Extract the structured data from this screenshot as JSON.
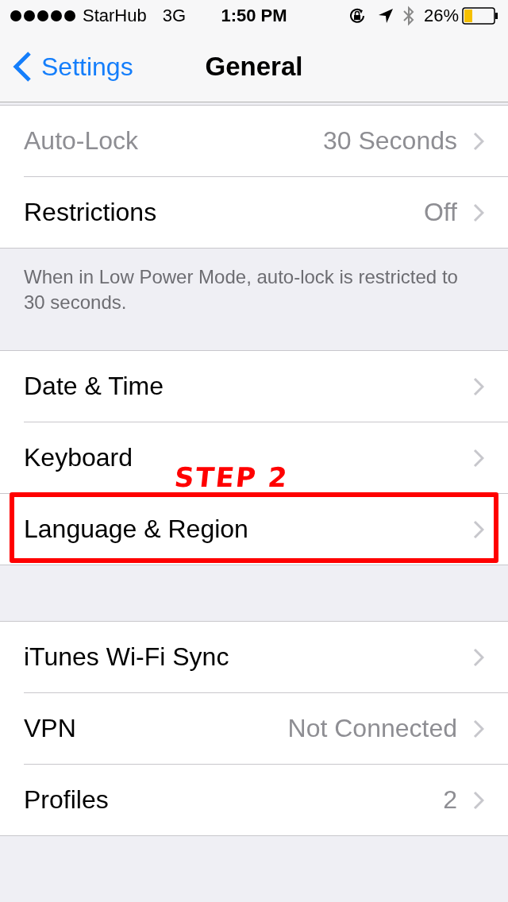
{
  "status_bar": {
    "carrier": "StarHub",
    "network": "3G",
    "time": "1:50 PM",
    "battery": "26%"
  },
  "nav": {
    "back": "Settings",
    "title": "General"
  },
  "groups": [
    {
      "rows": [
        {
          "label": "Auto-Lock",
          "value": "30 Seconds",
          "disabled": true,
          "highlighted": false
        },
        {
          "label": "Restrictions",
          "value": "Off",
          "disabled": false,
          "highlighted": false
        }
      ],
      "footer": "When in Low Power Mode, auto-lock is restricted to 30 seconds."
    },
    {
      "rows": [
        {
          "label": "Date & Time",
          "disabled": false,
          "highlighted": false
        },
        {
          "label": "Keyboard",
          "disabled": false,
          "highlighted": false,
          "annotation": "STEP 2"
        },
        {
          "label": "Language & Region",
          "disabled": false,
          "highlighted": true
        }
      ]
    },
    {
      "rows": [
        {
          "label": "iTunes Wi-Fi Sync",
          "disabled": false,
          "highlighted": false
        },
        {
          "label": "VPN",
          "value": "Not Connected",
          "disabled": false,
          "highlighted": false
        },
        {
          "label": "Profiles",
          "value": "2",
          "disabled": false,
          "highlighted": false
        }
      ]
    }
  ]
}
